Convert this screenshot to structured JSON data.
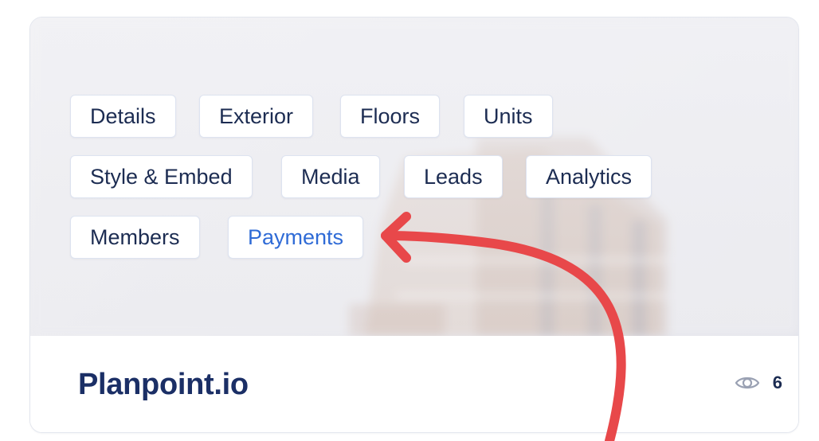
{
  "tabs": {
    "details": "Details",
    "exterior": "Exterior",
    "floors": "Floors",
    "units": "Units",
    "style_embed": "Style & Embed",
    "media": "Media",
    "leads": "Leads",
    "analytics": "Analytics",
    "members": "Members",
    "payments": "Payments"
  },
  "active_tab": "payments",
  "project": {
    "title": "Planpoint.io",
    "views": "6"
  },
  "icons": {
    "views": "eye-icon",
    "annotation": "curved-arrow-icon"
  },
  "colors": {
    "tab_text": "#1c2c52",
    "active_tab_text": "#2f6bd6",
    "title": "#1b2f66",
    "annotation_arrow": "#e8484a"
  }
}
